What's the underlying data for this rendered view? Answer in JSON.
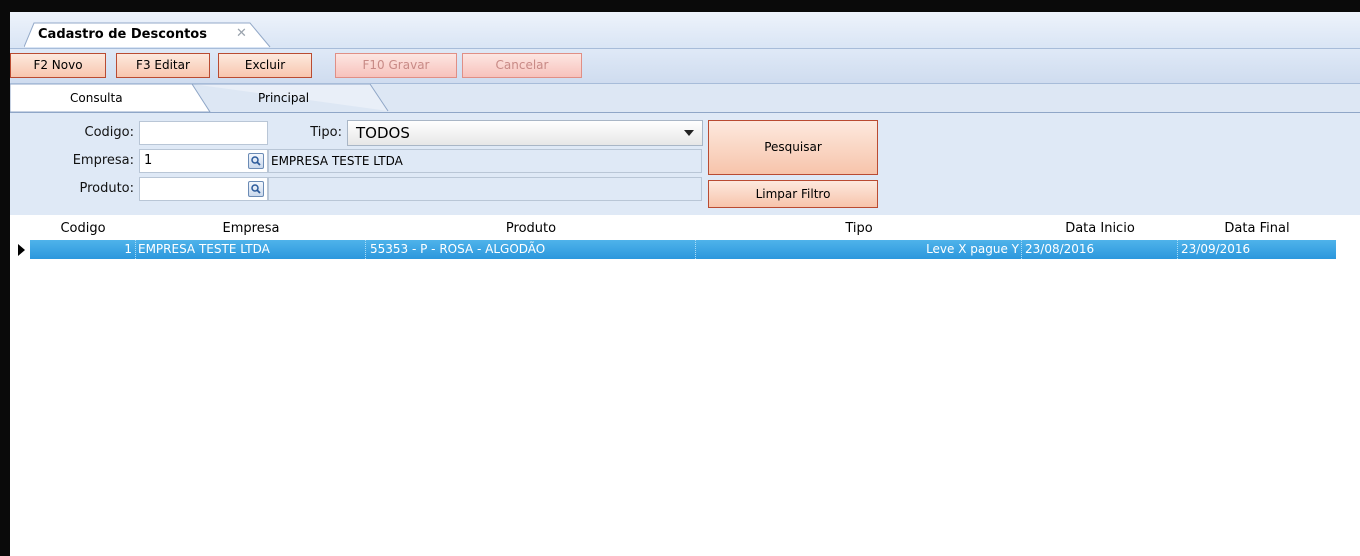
{
  "document_tab": {
    "title": "Cadastro de Descontos",
    "close": "✕"
  },
  "toolbar": {
    "new_label": "F2 Novo",
    "edit_label": "F3 Editar",
    "delete_label": "Excluir",
    "save_label": "F10 Gravar",
    "cancel_label": "Cancelar"
  },
  "form_tabs": {
    "consulta": "Consulta",
    "principal": "Principal"
  },
  "filter": {
    "codigo_label": "Codigo:",
    "codigo_value": "",
    "tipo_label": "Tipo:",
    "tipo_value": "TODOS",
    "empresa_label": "Empresa:",
    "empresa_value": "1",
    "empresa_name": "EMPRESA TESTE LTDA",
    "produto_label": "Produto:",
    "produto_value": "",
    "produto_name": "",
    "search_button": "Pesquisar",
    "clear_button": "Limpar Filtro"
  },
  "grid": {
    "columns": [
      "Codigo",
      "Empresa",
      "Produto",
      "Tipo",
      "Data Inicio",
      "Data Final"
    ],
    "rows": [
      {
        "codigo": "1",
        "empresa": "EMPRESA TESTE LTDA",
        "produto": "55353 - P - ROSA - ALGODÃO",
        "tipo": "Leve X pague Y",
        "data_inicio": "23/08/2016",
        "data_final": "23/09/2016"
      }
    ]
  },
  "colors": {
    "accent_row": "#2b97dd",
    "button_border": "#b94b32",
    "panel_bg": "#dfe9f6"
  }
}
